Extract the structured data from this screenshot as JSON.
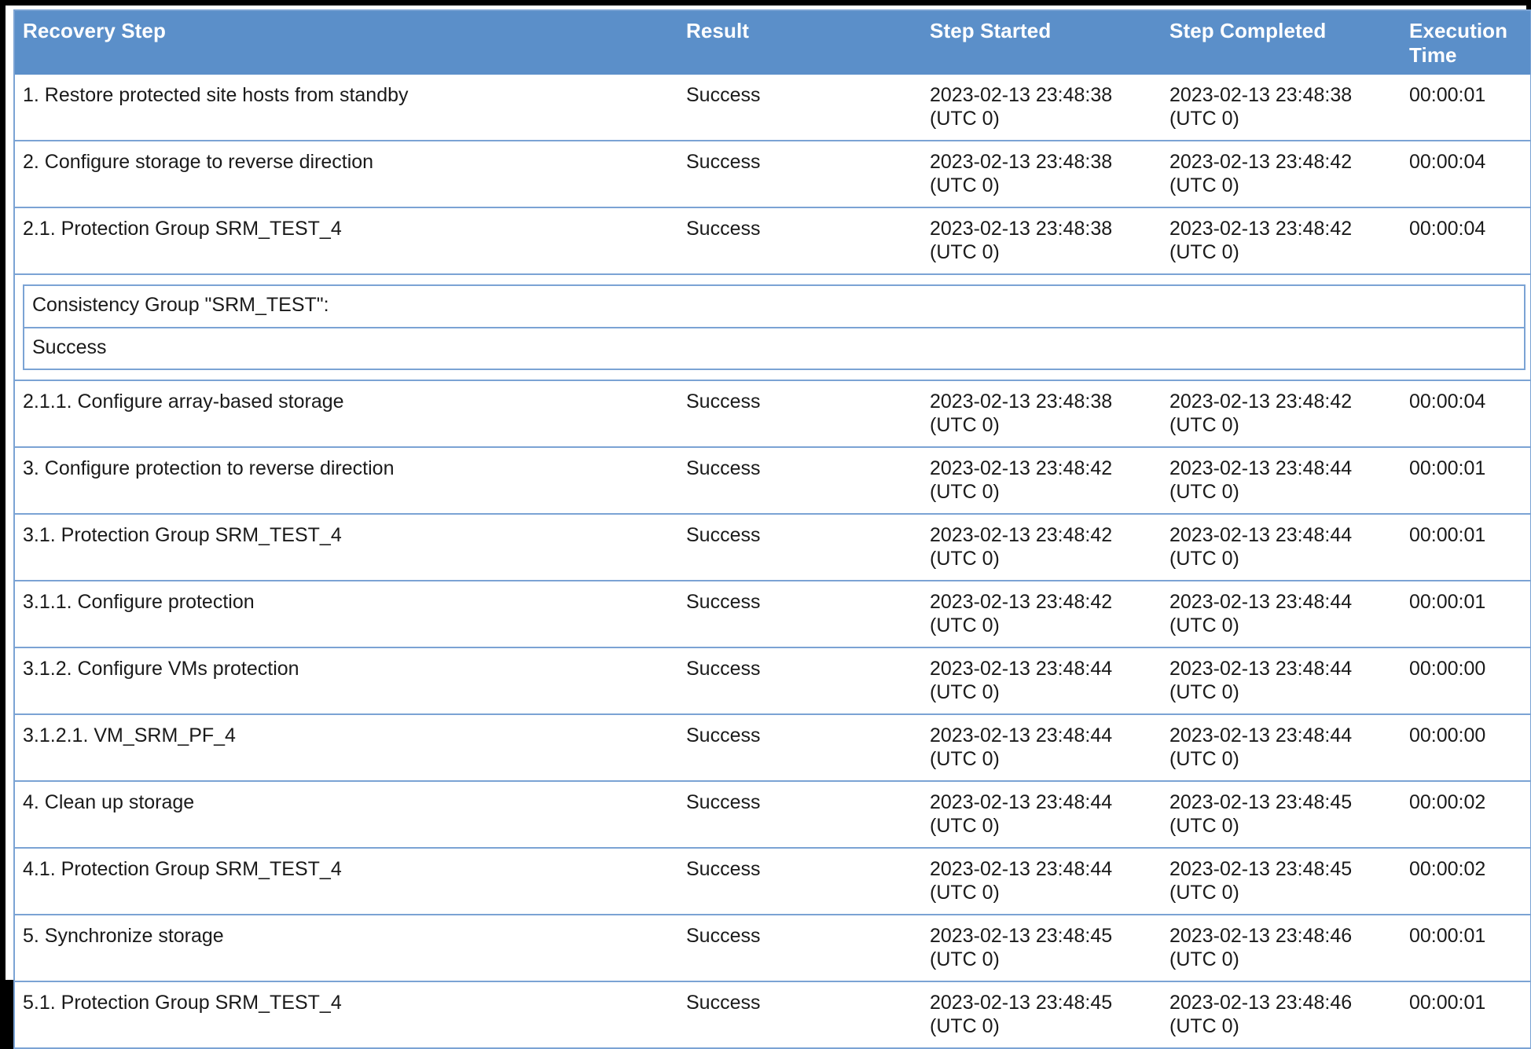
{
  "table": {
    "columns": [
      {
        "key": "step",
        "label": "Recovery Step"
      },
      {
        "key": "result",
        "label": "Result"
      },
      {
        "key": "started",
        "label": "Step Started"
      },
      {
        "key": "completed",
        "label": "Step Completed"
      },
      {
        "key": "exec",
        "label": "Execution Time"
      }
    ],
    "header_labels": {
      "recovery_step": "Recovery Step",
      "result": "Result",
      "step_started": "Step Started",
      "step_completed": "Step Completed",
      "execution_time_line1": "Execution",
      "execution_time_line2": "Time"
    },
    "colors": {
      "header_background": "#5b8fc9",
      "header_text": "#ffffff",
      "border": "#7ba3d4",
      "success_text": "#1f7a1f",
      "body_text": "#1a1a1a",
      "outer_frame": "#000000",
      "background": "#ffffff"
    },
    "rows": [
      {
        "step": "1. Restore protected site hosts from standby",
        "level": 1,
        "result": "Success",
        "started_date": "2023-02-13 23:48:38",
        "started_tz": "(UTC 0)",
        "completed_date": "2023-02-13 23:48:38",
        "completed_tz": "(UTC 0)",
        "exec": "00:00:01"
      },
      {
        "step": "2. Configure storage to reverse direction",
        "level": 1,
        "result": "Success",
        "started_date": "2023-02-13 23:48:38",
        "started_tz": "(UTC 0)",
        "completed_date": "2023-02-13 23:48:42",
        "completed_tz": "(UTC 0)",
        "exec": "00:00:04"
      },
      {
        "step": "2.1. Protection Group SRM_TEST_4",
        "level": 2,
        "result": "Success",
        "started_date": "2023-02-13 23:48:38",
        "started_tz": "(UTC 0)",
        "completed_date": "2023-02-13 23:48:42",
        "completed_tz": "(UTC 0)",
        "exec": "00:00:04"
      },
      {
        "step": "2.1.1. Configure array-based storage",
        "level": 3,
        "result": "Success",
        "started_date": "2023-02-13 23:48:38",
        "started_tz": "(UTC 0)",
        "completed_date": "2023-02-13 23:48:42",
        "completed_tz": "(UTC 0)",
        "exec": "00:00:04"
      },
      {
        "step": "3. Configure protection to reverse direction",
        "level": 1,
        "result": "Success",
        "started_date": "2023-02-13 23:48:42",
        "started_tz": "(UTC 0)",
        "completed_date": "2023-02-13 23:48:44",
        "completed_tz": "(UTC 0)",
        "exec": "00:00:01"
      },
      {
        "step": "3.1. Protection Group SRM_TEST_4",
        "level": 2,
        "result": "Success",
        "started_date": "2023-02-13 23:48:42",
        "started_tz": "(UTC 0)",
        "completed_date": "2023-02-13 23:48:44",
        "completed_tz": "(UTC 0)",
        "exec": "00:00:01"
      },
      {
        "step": "3.1.1. Configure protection",
        "level": 3,
        "result": "Success",
        "started_date": "2023-02-13 23:48:42",
        "started_tz": "(UTC 0)",
        "completed_date": "2023-02-13 23:48:44",
        "completed_tz": "(UTC 0)",
        "exec": "00:00:01"
      },
      {
        "step": "3.1.2. Configure VMs protection",
        "level": 3,
        "result": "Success",
        "started_date": "2023-02-13 23:48:44",
        "started_tz": "(UTC 0)",
        "completed_date": "2023-02-13 23:48:44",
        "completed_tz": "(UTC 0)",
        "exec": "00:00:00"
      },
      {
        "step": "3.1.2.1. VM_SRM_PF_4",
        "level": 4,
        "result": "Success",
        "started_date": "2023-02-13 23:48:44",
        "started_tz": "(UTC 0)",
        "completed_date": "2023-02-13 23:48:44",
        "completed_tz": "(UTC 0)",
        "exec": "00:00:00"
      },
      {
        "step": "4. Clean up storage",
        "level": 1,
        "result": "Success",
        "started_date": "2023-02-13 23:48:44",
        "started_tz": "(UTC 0)",
        "completed_date": "2023-02-13 23:48:45",
        "completed_tz": "(UTC 0)",
        "exec": "00:00:02"
      },
      {
        "step": "4.1. Protection Group SRM_TEST_4",
        "level": 2,
        "result": "Success",
        "started_date": "2023-02-13 23:48:44",
        "started_tz": "(UTC 0)",
        "completed_date": "2023-02-13 23:48:45",
        "completed_tz": "(UTC 0)",
        "exec": "00:00:02"
      },
      {
        "step": "5. Synchronize storage",
        "level": 1,
        "result": "Success",
        "started_date": "2023-02-13 23:48:45",
        "started_tz": "(UTC 0)",
        "completed_date": "2023-02-13 23:48:46",
        "completed_tz": "(UTC 0)",
        "exec": "00:00:01"
      },
      {
        "step": "5.1. Protection Group SRM_TEST_4",
        "level": 2,
        "result": "Success",
        "started_date": "2023-02-13 23:48:45",
        "started_tz": "(UTC 0)",
        "completed_date": "2023-02-13 23:48:46",
        "completed_tz": "(UTC 0)",
        "exec": "00:00:01"
      }
    ],
    "nested_detail": {
      "title": "Consistency Group \"SRM_TEST\":",
      "result": "Success"
    }
  }
}
